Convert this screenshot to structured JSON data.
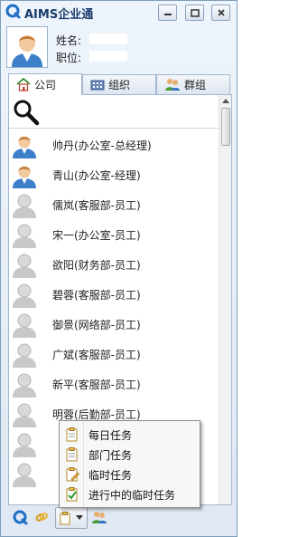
{
  "app": {
    "title": "AIMS企业通"
  },
  "window_controls": [
    "minimize-button",
    "maximize-button",
    "close-button"
  ],
  "profile": {
    "name_label": "姓名:",
    "position_label": "职位:"
  },
  "tabs": [
    {
      "label": "公司",
      "icon": "home-icon",
      "active": true
    },
    {
      "label": "组织",
      "icon": "org-icon",
      "active": false
    },
    {
      "label": "群组",
      "icon": "group-icon",
      "active": false
    }
  ],
  "contacts": [
    {
      "name": "帅丹(办公室-总经理)",
      "online": true
    },
    {
      "name": "青山(办公室-经理)",
      "online": true
    },
    {
      "name": "儒岚(客服部-员工)",
      "online": false
    },
    {
      "name": "宋一(办公室-员工)",
      "online": false
    },
    {
      "name": "欲阳(财务部-员工)",
      "online": false
    },
    {
      "name": "碧蓉(客服部-员工)",
      "online": false
    },
    {
      "name": "御景(网络部-员工)",
      "online": false
    },
    {
      "name": "广斌(客服部-员工)",
      "online": false
    },
    {
      "name": "新平(客服部-员工)",
      "online": false
    },
    {
      "name": "明蓉(后勤部-员工)",
      "online": false
    }
  ],
  "task_menu": {
    "items": [
      {
        "label": "每日任务",
        "icon": "daily-task-icon"
      },
      {
        "label": "部门任务",
        "icon": "dept-task-icon"
      },
      {
        "label": "临时任务",
        "icon": "temp-task-icon"
      },
      {
        "label": "进行中的临时任务",
        "icon": "inprogress-task-icon"
      }
    ]
  },
  "bottombar": [
    "aims-logo-icon",
    "link-icon",
    "task-menu-button",
    "contacts-icon"
  ]
}
